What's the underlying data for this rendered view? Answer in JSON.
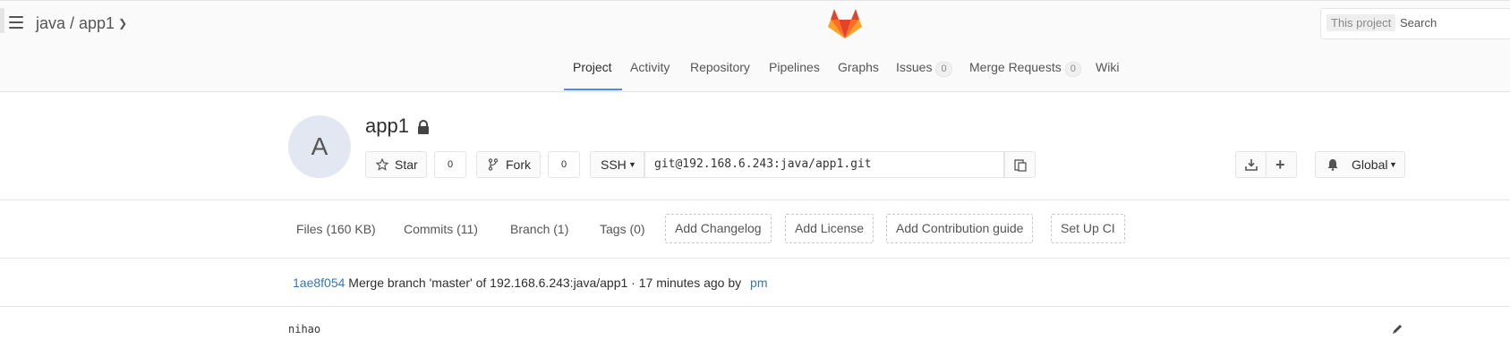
{
  "header": {
    "breadcrumb": "java / app1",
    "search_scope": "This project",
    "search_placeholder": "Search"
  },
  "nav": {
    "tabs": [
      {
        "label": "Project",
        "active": true
      },
      {
        "label": "Activity"
      },
      {
        "label": "Repository"
      },
      {
        "label": "Pipelines"
      },
      {
        "label": "Graphs"
      },
      {
        "label": "Issues",
        "count": "0"
      },
      {
        "label": "Merge Requests",
        "count": "0"
      },
      {
        "label": "Wiki"
      }
    ]
  },
  "project": {
    "avatar_letter": "A",
    "name": "app1",
    "star_label": "Star",
    "star_count": "0",
    "fork_label": "Fork",
    "fork_count": "0",
    "protocol": "SSH",
    "clone_url": "git@192.168.6.243:java/app1.git",
    "notification_label": "Global"
  },
  "stats": {
    "files": "Files (160 KB)",
    "commits": "Commits (11)",
    "branch": "Branch (1)",
    "tags": "Tags (0)",
    "add_changelog": "Add Changelog",
    "add_license": "Add License",
    "add_contribution": "Add Contribution guide",
    "setup_ci": "Set Up CI"
  },
  "last_commit": {
    "sha": "1ae8f054",
    "message": "Merge branch 'master' of 192.168.6.243:java/app1 · 17 minutes ago by",
    "author": "pm"
  },
  "readme": {
    "text": "nihao"
  },
  "colors": {
    "link": "#3777b0",
    "active_tab": "#4a8bee"
  }
}
